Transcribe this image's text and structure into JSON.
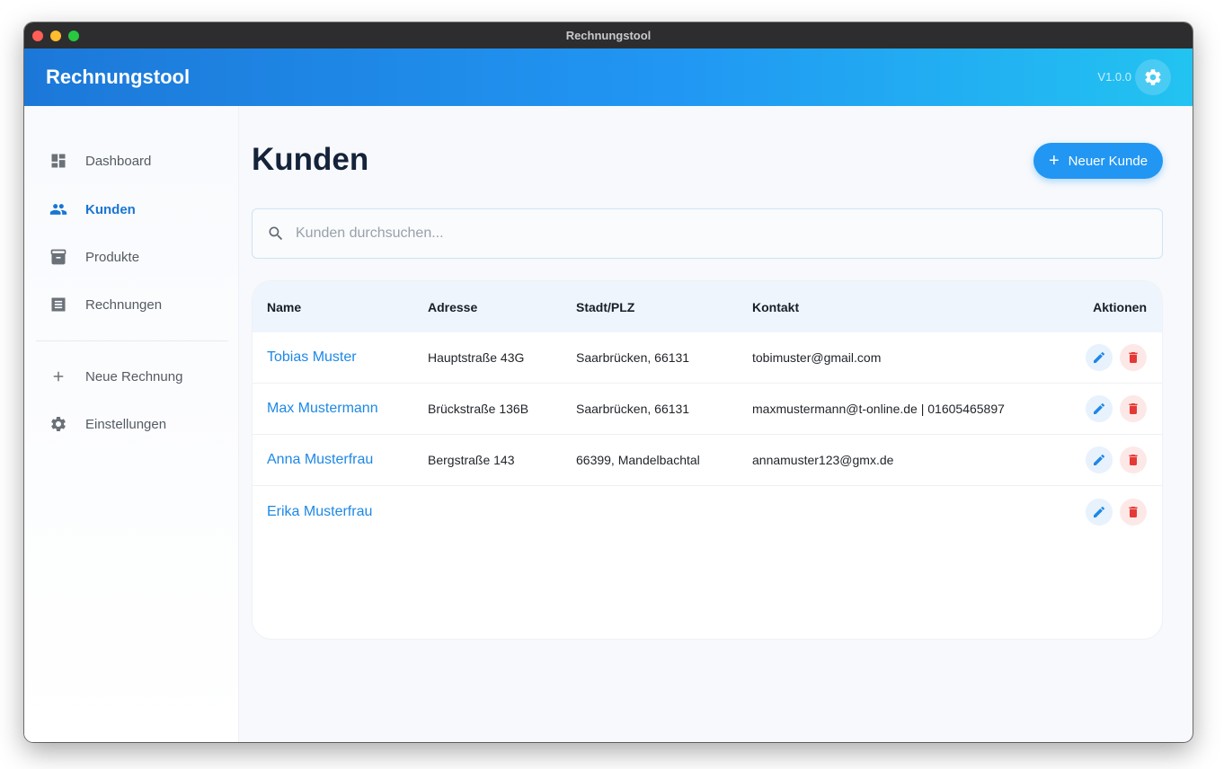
{
  "window": {
    "title": "Rechnungstool"
  },
  "header": {
    "app_title": "Rechnungstool",
    "version": "V1.0.0",
    "settings_icon": "gear-icon"
  },
  "sidebar": {
    "items": [
      {
        "label": "Dashboard",
        "icon": "dashboard-icon",
        "active": false
      },
      {
        "label": "Kunden",
        "icon": "people-icon",
        "active": true
      },
      {
        "label": "Produkte",
        "icon": "archive-icon",
        "active": false
      },
      {
        "label": "Rechnungen",
        "icon": "receipt-icon",
        "active": false
      },
      {
        "label": "Neue Rechnung",
        "icon": "plus-icon",
        "active": false
      },
      {
        "label": "Einstellungen",
        "icon": "gear-icon",
        "active": false
      }
    ]
  },
  "main": {
    "title": "Kunden",
    "new_button_label": "Neuer Kunde",
    "search_placeholder": "Kunden durchsuchen...",
    "search_value": "",
    "table": {
      "headers": {
        "name": "Name",
        "address": "Adresse",
        "city": "Stadt/PLZ",
        "contact": "Kontakt",
        "actions": "Aktionen"
      },
      "rows": [
        {
          "name": "Tobias Muster",
          "address": "Hauptstraße 43G",
          "city": "Saarbrücken, 66131",
          "contact": "tobimuster@gmail.com"
        },
        {
          "name": "Max Mustermann",
          "address": "Brückstraße 136B",
          "city": "Saarbrücken, 66131",
          "contact": "maxmustermann@t-online.de | 01605465897"
        },
        {
          "name": "Anna Musterfrau",
          "address": "Bergstraße 143",
          "city": "66399, Mandelbachtal",
          "contact": "annamuster123@gmx.de"
        },
        {
          "name": "Erika Musterfrau",
          "address": "",
          "city": "",
          "contact": ""
        }
      ]
    }
  },
  "colors": {
    "accent": "#2196f3",
    "active_nav": "#1976d2",
    "delete": "#e53935"
  }
}
